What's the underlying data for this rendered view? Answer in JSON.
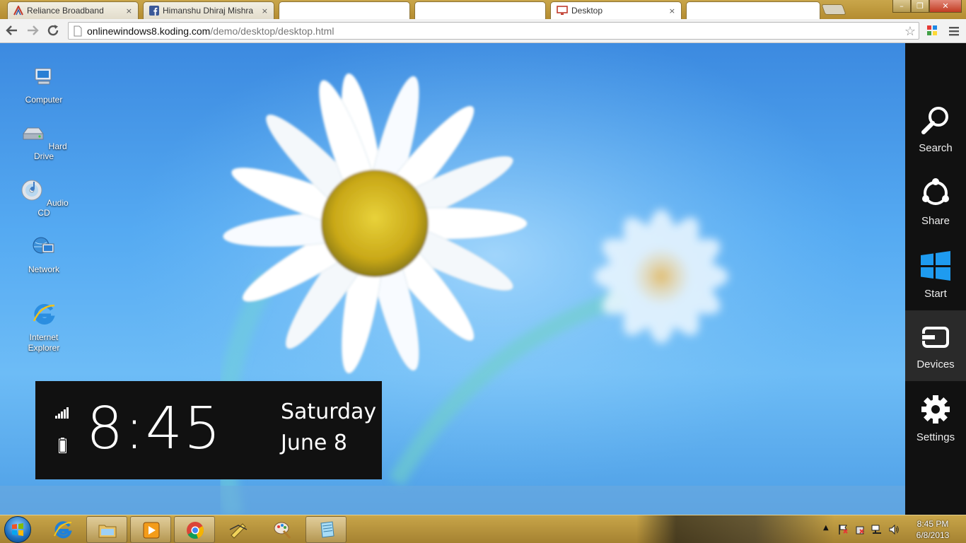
{
  "browser": {
    "tabs": [
      {
        "title": "Reliance Broadband",
        "icon": "reliance-icon",
        "close": "×"
      },
      {
        "title": "Himanshu Dhiraj Mishra",
        "icon": "facebook-icon",
        "close": "×"
      },
      {
        "title": "",
        "icon": "",
        "close": ""
      },
      {
        "title": "",
        "icon": "",
        "close": ""
      },
      {
        "title": "Desktop",
        "icon": "desktop-monitor-icon",
        "close": "×"
      },
      {
        "title": "",
        "icon": "",
        "close": ""
      }
    ],
    "url_host": "onlinewindows8.koding.com",
    "url_path": "/demo/desktop/desktop.html",
    "window_controls": {
      "minimize": "–",
      "maximize": "❐",
      "close": "✕"
    }
  },
  "desktop": {
    "icons": [
      {
        "label": "Computer",
        "icon": "computer-icon"
      },
      {
        "label": "Hard Drive",
        "icon": "hard-drive-icon"
      },
      {
        "label": "Audio CD",
        "icon": "audio-cd-icon"
      },
      {
        "label": "Network",
        "icon": "network-icon"
      },
      {
        "label": "Internet\nExplorer",
        "icon": "internet-explorer-icon"
      }
    ]
  },
  "clock_overlay": {
    "time": "8:45",
    "day": "Saturday",
    "date": "June 8"
  },
  "charms": [
    {
      "label": "Search",
      "icon": "search-icon"
    },
    {
      "label": "Share",
      "icon": "share-icon"
    },
    {
      "label": "Start",
      "icon": "windows-logo-icon"
    },
    {
      "label": "Devices",
      "icon": "devices-icon"
    },
    {
      "label": "Settings",
      "icon": "settings-gear-icon"
    }
  ],
  "taskbar": {
    "time": "8:45 PM",
    "date": "6/8/2013",
    "pinned": [
      "internet-explorer-icon",
      "file-explorer-icon",
      "media-player-icon",
      "chrome-icon",
      "sketch-app-icon",
      "paint-icon",
      "notepad-icon"
    ]
  },
  "colors": {
    "tab_strip": "#b48c30",
    "charms_bg": "#111111",
    "windows_blue": "#1e88e5",
    "sky": "#55aaf2"
  }
}
